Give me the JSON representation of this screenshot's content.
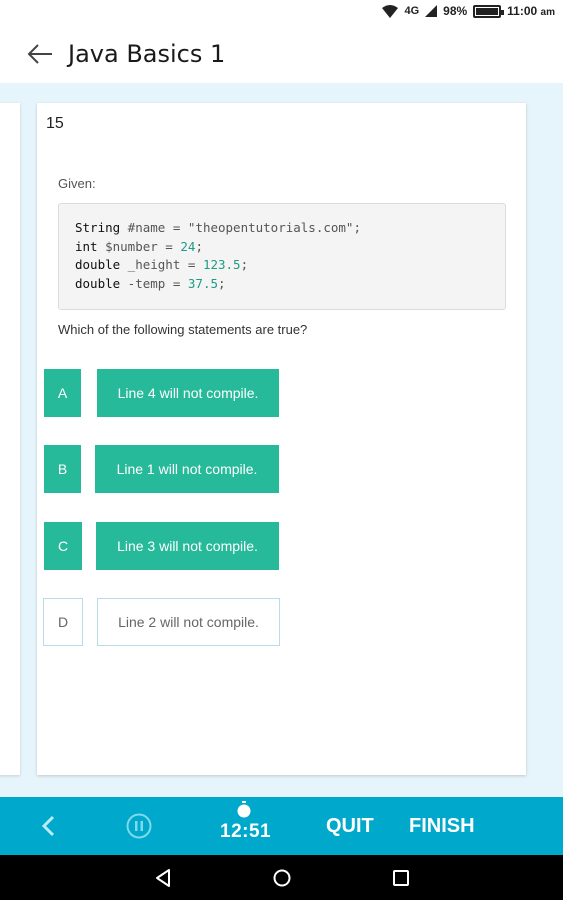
{
  "status_bar": {
    "network": "4G",
    "battery": "98%",
    "battery_level": 0.98,
    "time": "11:00",
    "ampm": "am"
  },
  "app_bar": {
    "title": "Java Basics 1"
  },
  "question": {
    "number": "15",
    "given_label": "Given:",
    "code": [
      {
        "kw": "String",
        "rest": " #name = \"theopentutorials.com\";",
        "num": ""
      },
      {
        "kw": "int",
        "rest": " $number = ",
        "num": "24",
        "end": ";"
      },
      {
        "kw": "double",
        "rest": " _height = ",
        "num": "123.5",
        "end": ";"
      },
      {
        "kw": "double",
        "rest": " -temp = ",
        "num": "37.5",
        "end": ";"
      }
    ],
    "prompt": "Which of the following statements are true?",
    "options": [
      {
        "letter": "A",
        "text": "Line 4 will not compile.",
        "selected": true
      },
      {
        "letter": "B",
        "text": "Line 1 will not compile.",
        "selected": true
      },
      {
        "letter": "C",
        "text": "Line 3 will not compile.",
        "selected": true
      },
      {
        "letter": "D",
        "text": "Line 2 will not compile.",
        "selected": false
      }
    ]
  },
  "toolbar": {
    "timer": "12:51",
    "quit_label": "QUIT",
    "finish_label": "FINISH"
  },
  "colors": {
    "accent_green": "#26b99a",
    "toolbar_blue": "#00a9cc",
    "content_bg": "#e6f5fb"
  }
}
